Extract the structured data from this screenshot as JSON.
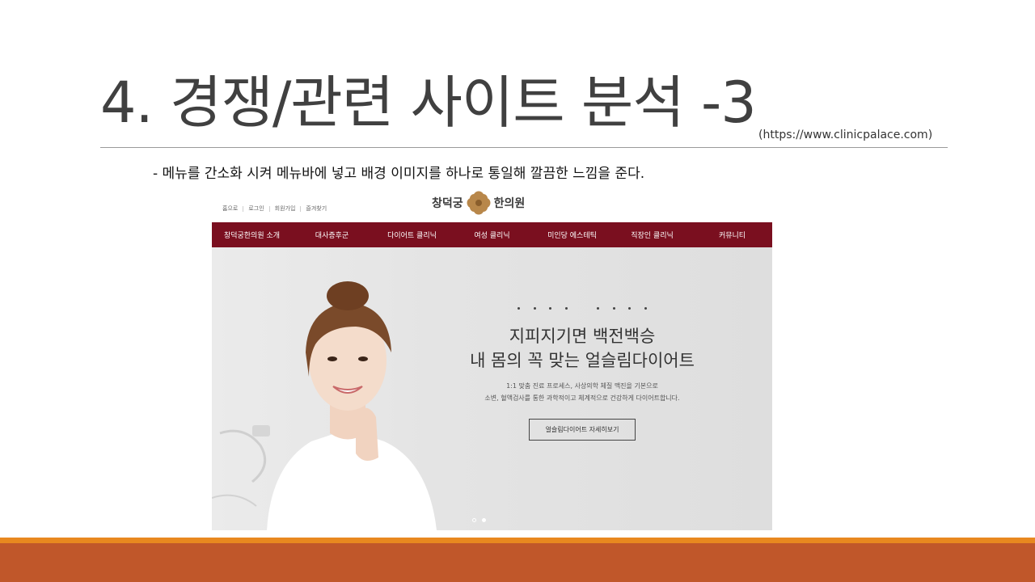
{
  "slide": {
    "title": "4. 경쟁/관련 사이트 분석 -3",
    "url": "(https://www.clinicpalace.com)",
    "description": "- 메뉴를 간소화 시켜 메뉴바에 넣고 배경 이미지를 하나로 통일해 깔끔한 느낌을 준다."
  },
  "site": {
    "util_links": [
      "홈으로",
      "로그인",
      "회원가입",
      "즐겨찾기"
    ],
    "logo": {
      "left": "창덕궁",
      "right": "한의원"
    },
    "nav": [
      "창덕궁한의원 소개",
      "대사증후군",
      "다이어트 클리닉",
      "여성 클리닉",
      "미인당 에스테틱",
      "직장인 클리닉",
      "커뮤니티"
    ],
    "hero": {
      "headline1": "지피지기면 백전백승",
      "headline2": "내 몸의 꼭 맞는 얼슬림다이어트",
      "copy1": "1:1 맞춤 진료 프로세스, 사상의학 체질 맥진을 기본으로",
      "copy2": "소변, 혈액검사를 통한 과학적이고 체계적으로 건강하게 다이어트합니다.",
      "button": "얼슬림다이어트 자세히보기",
      "slides_total": 2,
      "slide_active": 2
    }
  },
  "colors": {
    "nav_bg": "#7a0f1f",
    "band_top": "#e8881f",
    "band_bottom": "#c0572a",
    "logo_mark": "#b8874a"
  }
}
